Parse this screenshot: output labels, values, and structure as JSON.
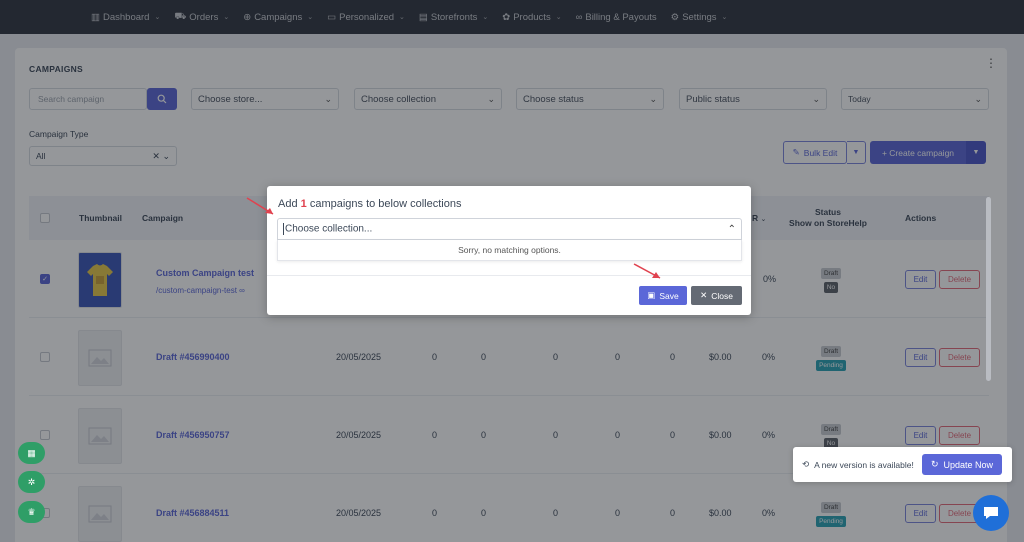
{
  "nav": {
    "items": [
      {
        "label": "Dashboard",
        "icon": "chart-icon"
      },
      {
        "label": "Orders",
        "icon": "cart-icon"
      },
      {
        "label": "Campaigns",
        "icon": "campaign-icon"
      },
      {
        "label": "Personalized",
        "icon": "personalized-icon"
      },
      {
        "label": "Storefronts",
        "icon": "storefront-icon"
      },
      {
        "label": "Products",
        "icon": "products-icon"
      },
      {
        "label": "Billing & Payouts",
        "icon": "billing-icon"
      },
      {
        "label": "Settings",
        "icon": "gear-icon"
      }
    ]
  },
  "page": {
    "title": "CAMPAIGNS",
    "search_placeholder": "Search campaign",
    "filters": {
      "store": "Choose store...",
      "collection": "Choose collection",
      "status": "Choose status",
      "public": "Public status",
      "date": "Today"
    },
    "campaign_type_label": "Campaign Type",
    "campaign_type_value": "All",
    "bulk_edit": "Bulk Edit",
    "create_campaign": "+ Create campaign"
  },
  "table": {
    "headers": {
      "thumbnail": "Thumbnail",
      "campaign": "Campaign",
      "r": "R",
      "status_line1": "Status",
      "status_line2": "Show on StoreHelp",
      "actions": "Actions"
    },
    "rows": [
      {
        "name": "Custom Campaign test",
        "slug": "/custom-campaign-test",
        "checked": true,
        "date": "",
        "c1": "",
        "c2": "",
        "c3": "",
        "c4": "",
        "c5": "",
        "amount": "",
        "pct": "0%",
        "status": "Draft",
        "badge": "No",
        "badge_color": "dark",
        "edit": "Edit",
        "delete": "Delete"
      },
      {
        "name": "Draft #456990400",
        "slug": "",
        "checked": false,
        "date": "20/05/2025",
        "c1": "0",
        "c2": "0",
        "c3": "0",
        "c4": "0",
        "c5": "0",
        "amount": "$0.00",
        "pct": "0%",
        "status": "Draft",
        "badge": "Pending",
        "badge_color": "teal",
        "edit": "Edit",
        "delete": "Delete"
      },
      {
        "name": "Draft #456950757",
        "slug": "",
        "checked": false,
        "date": "20/05/2025",
        "c1": "0",
        "c2": "0",
        "c3": "0",
        "c4": "0",
        "c5": "0",
        "amount": "$0.00",
        "pct": "0%",
        "status": "Draft",
        "badge": "No",
        "badge_color": "dark",
        "edit": "Edit",
        "delete": "Delete"
      },
      {
        "name": "Draft #456884511",
        "slug": "",
        "checked": false,
        "date": "20/05/2025",
        "c1": "0",
        "c2": "0",
        "c3": "0",
        "c4": "0",
        "c5": "0",
        "amount": "$0.00",
        "pct": "0%",
        "status": "Draft",
        "badge": "Pending",
        "badge_color": "teal",
        "edit": "Edit",
        "delete": "Delete"
      }
    ]
  },
  "modal": {
    "title_pre": "Add",
    "count": "1",
    "title_post": "campaigns to below collections",
    "placeholder": "Choose collection...",
    "no_options": "Sorry, no matching options.",
    "save": "Save",
    "close": "Close"
  },
  "toast": {
    "message": "A new version is available!",
    "button": "Update Now"
  },
  "colors": {
    "accent": "#5b67d8",
    "danger": "#e36a7a",
    "nav_bg": "#313640",
    "annotation": "#e0424f"
  }
}
